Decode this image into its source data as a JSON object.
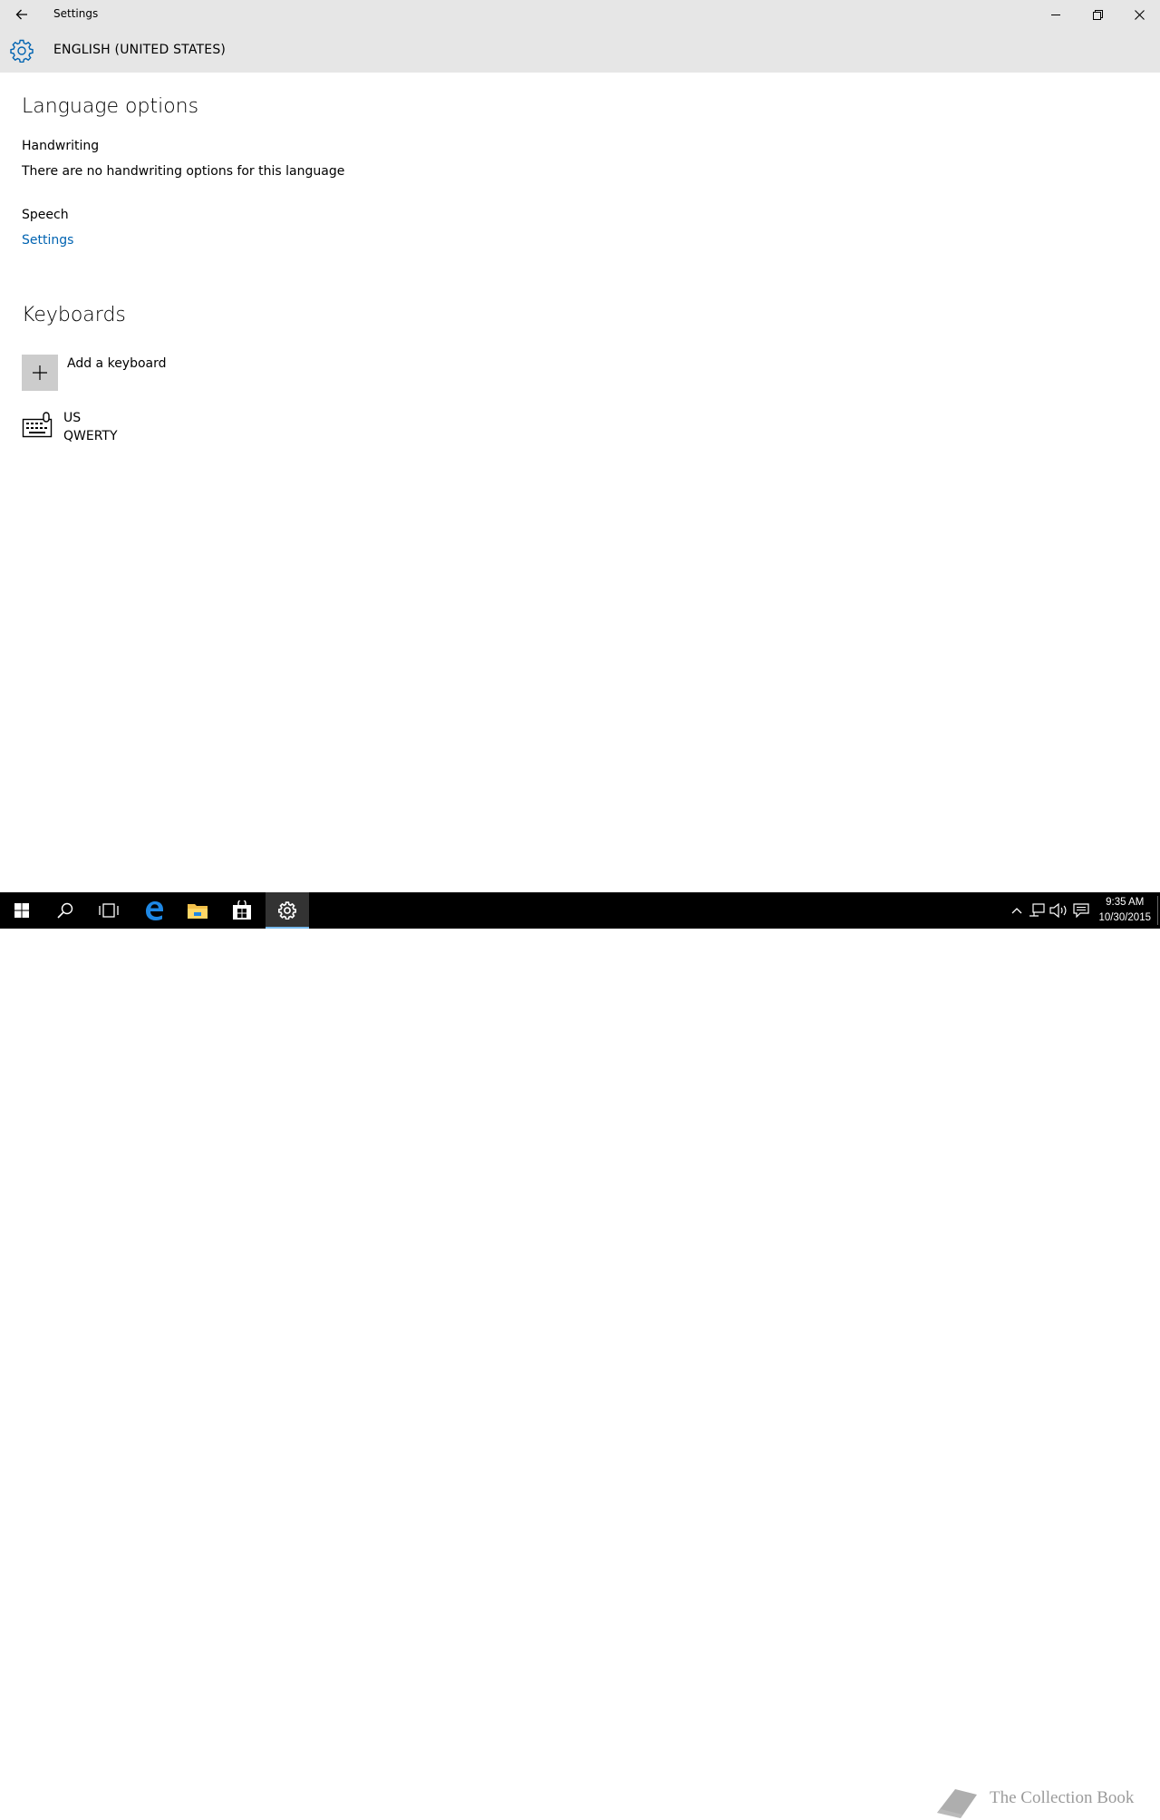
{
  "window": {
    "title": "Settings",
    "controls": [
      "minimize",
      "restore",
      "close"
    ]
  },
  "header": {
    "title": "ENGLISH (UNITED STATES)",
    "icon": "gear-icon"
  },
  "language_options": {
    "heading": "Language options",
    "handwriting": {
      "label": "Handwriting",
      "message": "There are no handwriting options for this language"
    },
    "speech": {
      "label": "Speech",
      "link": "Settings"
    }
  },
  "keyboards": {
    "heading": "Keyboards",
    "add_label": "Add a keyboard",
    "items": [
      {
        "name": "US",
        "layout": "QWERTY"
      }
    ]
  },
  "taskbar": {
    "apps": [
      "start",
      "search",
      "task-view",
      "edge",
      "file-explorer",
      "store",
      "settings"
    ],
    "active_app": "settings",
    "clock": {
      "time": "9:35 AM",
      "date": "10/30/2015"
    },
    "watermark": "The Collection Book"
  },
  "colors": {
    "accent": "#0063b1",
    "titlebar": "#e6e6e6",
    "taskbar": "#000000"
  }
}
